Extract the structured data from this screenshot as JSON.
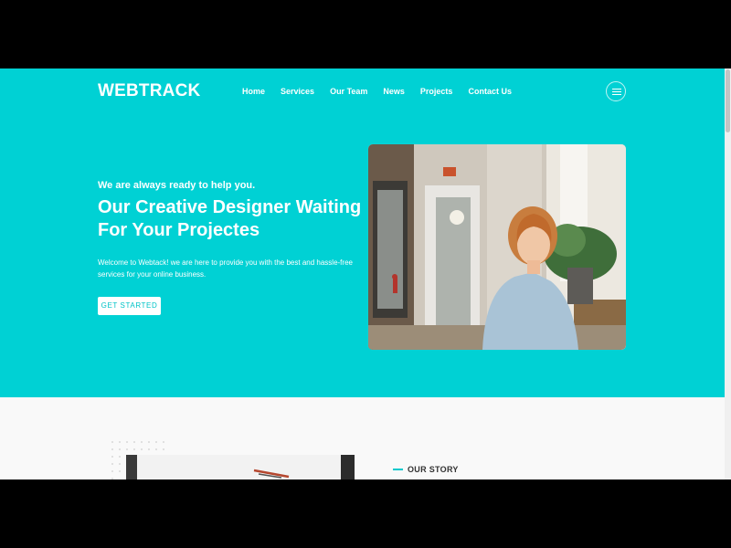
{
  "header": {
    "brand": "WEBTRACK",
    "nav": [
      "Home",
      "Services",
      "Our Team",
      "News",
      "Projects",
      "Contact Us"
    ]
  },
  "hero": {
    "tagline": "We are always ready to help you.",
    "headline": "Our Creative Designer Waiting For Your Projectes",
    "description": "Welcome to Webtack! we are here to provide you with the best and hassle-free services for your online business.",
    "cta": "GET STARTED"
  },
  "story": {
    "label": "OUR STORY"
  },
  "colors": {
    "accent": "#00d1d4",
    "dark": "#333333"
  }
}
